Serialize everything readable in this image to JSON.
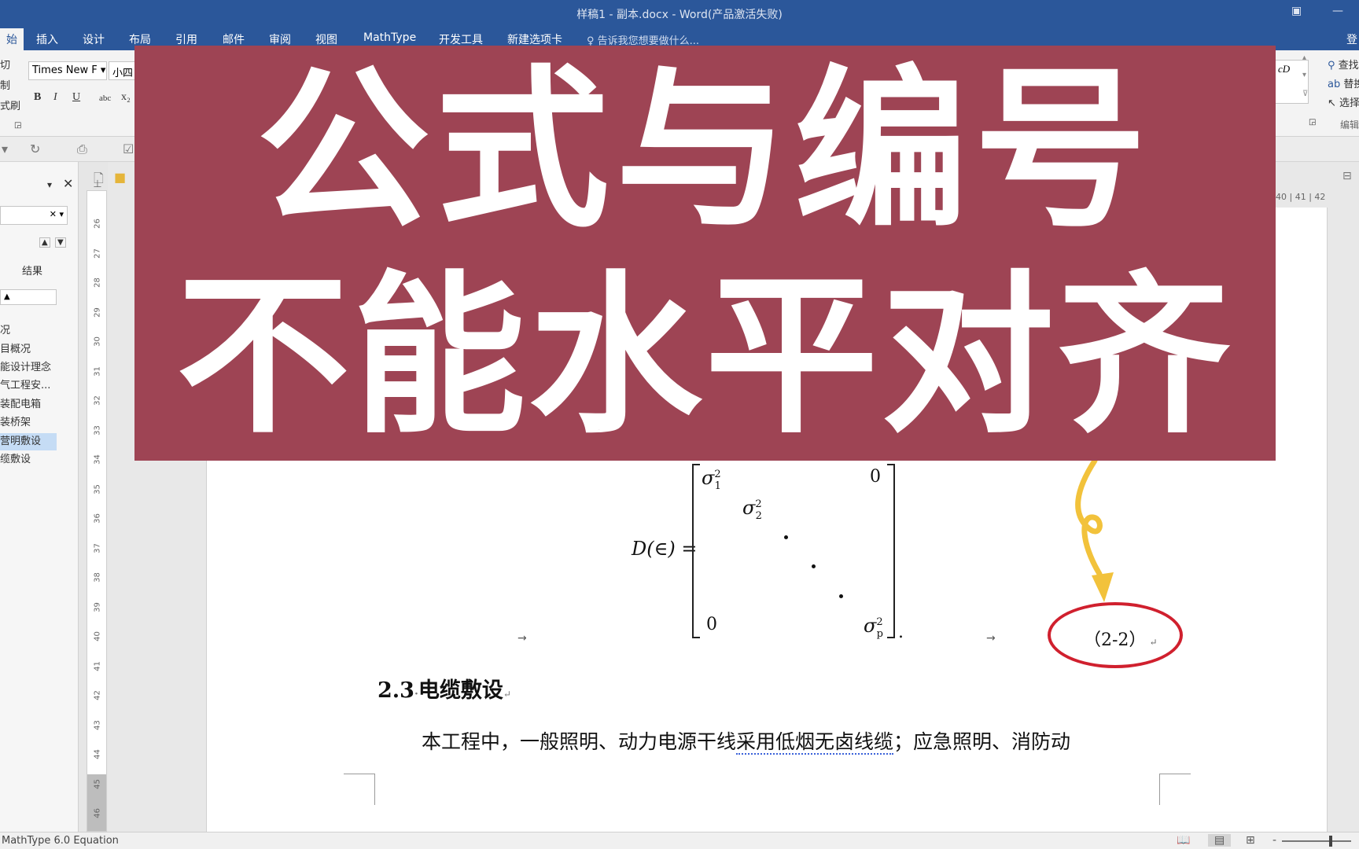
{
  "window": {
    "title": "样稿1 - 副本.docx - Word(产品激活失败)",
    "restore_icon": "restore-icon",
    "minimize_label": "—",
    "signin_label": "登"
  },
  "ribbon_tabs": [
    {
      "label": "始",
      "active": true
    },
    {
      "label": "插入"
    },
    {
      "label": "设计"
    },
    {
      "label": "布局"
    },
    {
      "label": "引用"
    },
    {
      "label": "邮件"
    },
    {
      "label": "审阅"
    },
    {
      "label": "视图"
    },
    {
      "label": "MathType"
    },
    {
      "label": "开发工具"
    },
    {
      "label": "新建选项卡"
    }
  ],
  "tellme": {
    "icon": "lightbulb-icon",
    "text": "告诉我您想要做什么..."
  },
  "ribbon": {
    "clipboard_items": [
      "切",
      "制",
      "式刷"
    ],
    "font_name": "Times New F",
    "font_size": "小四",
    "format_buttons": [
      "B",
      "I",
      "U",
      "abc",
      "x₂"
    ],
    "style_preview": "cD",
    "edit_items": [
      "查找",
      "替换",
      "选择"
    ],
    "edit_group_label": "编辑"
  },
  "navpane": {
    "results_label": "结果",
    "items": [
      {
        "label": "况"
      },
      {
        "label": "目概况"
      },
      {
        "label": "能设计理念"
      },
      {
        "label": "气工程安..."
      },
      {
        "label": "装配电箱"
      },
      {
        "label": "装桥架"
      },
      {
        "label": "营明敷设",
        "selected": true
      },
      {
        "label": "缆敷设"
      }
    ]
  },
  "vruler_ticks": [
    "26",
    "27",
    "28",
    "29",
    "30",
    "31",
    "32",
    "33",
    "34",
    "35",
    "36",
    "37",
    "38",
    "39",
    "40",
    "41",
    "42",
    "43",
    "44",
    "45",
    "46"
  ],
  "hruler_right": "40 | 41 | 42",
  "banner": {
    "line1": "公式与编号",
    "line2": "不能水平对齐"
  },
  "equation": {
    "lhs": "D(∈) =",
    "sigma": "σ",
    "sup": "2",
    "sub1": "1",
    "sub2": "2",
    "subp": "p",
    "zero": "0",
    "trailing": ".",
    "number": "（2-2）",
    "para_mark": "↵",
    "tab_arrow": "→"
  },
  "doc": {
    "heading_num": "2.3",
    "heading_text": "电缆敷设",
    "para_before": "本工程中，一般照明、动力电源干线",
    "para_underlined": "采用低烟无卤线缆",
    "para_after": "；应急照明、消防动"
  },
  "status": {
    "text": "MathType 6.0 Equation",
    "zoom_minus": "-"
  },
  "colors": {
    "ribbon_blue": "#2b579a",
    "banner": "#9e4454",
    "highlight_red": "#d0202e",
    "arrow_yellow": "#f2c23b"
  }
}
